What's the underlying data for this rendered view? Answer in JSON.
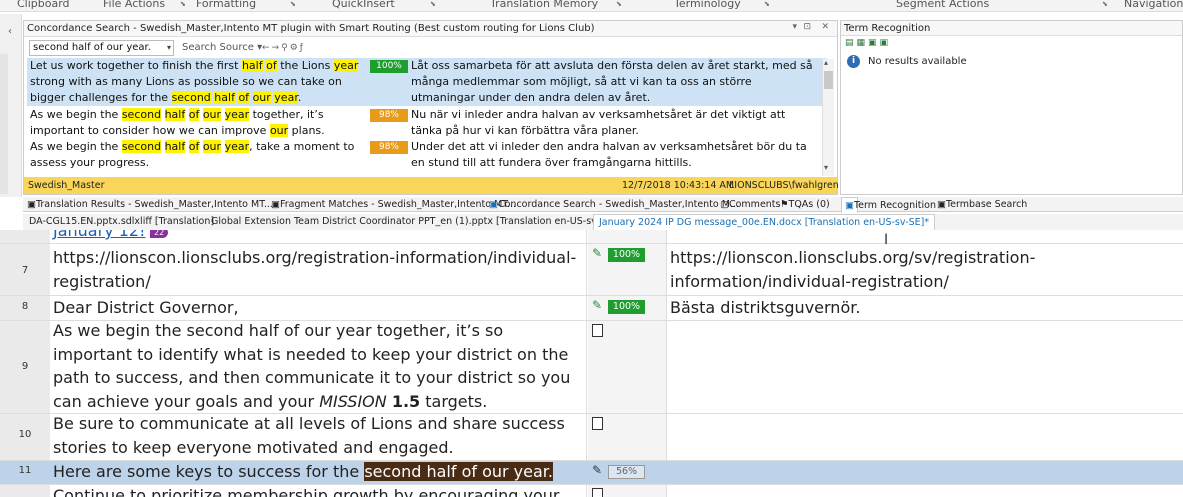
{
  "ribbon": {
    "groups": [
      "Clipboard",
      "File Actions",
      "Formatting",
      "QuickInsert",
      "Translation Memory",
      "Terminology",
      "Segment Actions",
      "Navigation"
    ]
  },
  "concordance": {
    "title": "Concordance Search - Swedish_Master,Intento MT plugin with Smart Routing (Best custom routing for Lions Club)",
    "search_value": "second half of our year.",
    "search_source_label": "Search Source",
    "results": [
      {
        "source": [
          {
            "t": "Let us work together to finish the first "
          },
          {
            "t": "half",
            "h": true
          },
          {
            "t": " "
          },
          {
            "t": "of",
            "h": true
          },
          {
            "t": " the Lions "
          },
          {
            "t": "year",
            "h": true
          },
          {
            "t": " strong with as many Lions as possible so we can take on bigger challenges for the "
          },
          {
            "t": "second",
            "h": true
          },
          {
            "t": " "
          },
          {
            "t": "half",
            "h": true
          },
          {
            "t": " "
          },
          {
            "t": "of",
            "h": true
          },
          {
            "t": " "
          },
          {
            "t": "our",
            "h": true
          },
          {
            "t": " "
          },
          {
            "t": "year",
            "h": true
          },
          {
            "t": "."
          }
        ],
        "score": "100%",
        "target": "Låt oss samarbeta för att avsluta den första delen av året starkt, med så många medlemmar som möjligt, så att vi kan ta oss an större utmaningar under den andra delen av året."
      },
      {
        "source": [
          {
            "t": "As we begin the "
          },
          {
            "t": "second",
            "h": true
          },
          {
            "t": " "
          },
          {
            "t": "half",
            "h": true
          },
          {
            "t": " "
          },
          {
            "t": "of",
            "h": true
          },
          {
            "t": " "
          },
          {
            "t": "our",
            "h": true
          },
          {
            "t": " "
          },
          {
            "t": "year",
            "h": true
          },
          {
            "t": " together, it’s important to consider how we can improve "
          },
          {
            "t": "our",
            "h": true
          },
          {
            "t": " plans."
          }
        ],
        "score": "98%",
        "target": "Nu när vi inleder andra halvan av verksamhetsåret är det viktigt att tänka på hur vi kan förbättra våra planer."
      },
      {
        "source": [
          {
            "t": "As we begin the "
          },
          {
            "t": "second",
            "h": true
          },
          {
            "t": " "
          },
          {
            "t": "half",
            "h": true
          },
          {
            "t": " "
          },
          {
            "t": "of",
            "h": true
          },
          {
            "t": " "
          },
          {
            "t": "our",
            "h": true
          },
          {
            "t": " "
          },
          {
            "t": "year",
            "h": true
          },
          {
            "t": ", take a moment to assess your progress."
          }
        ],
        "score": "98%",
        "target": "Under det att vi inleder den andra halvan av verksamhetsåret bör du ta en stund till att fundera över framgångarna hittills."
      }
    ],
    "status_tm": "Swedish_Master",
    "status_date": "12/7/2018 10:43:14 AM",
    "status_user": "LIONSCLUBS\\fwahlgren"
  },
  "term_recognition": {
    "title": "Term Recognition",
    "message": "No results available"
  },
  "bottom_tabs": [
    "Translation Results - Swedish_Master,Intento MT...",
    "Fragment Matches - Swedish_Master,Intento MT...",
    "Concordance Search - Swedish_Master,Intento M...",
    "Comments",
    "TQAs (0)",
    "Term Recognition",
    "Termbase Search"
  ],
  "doc_tabs": [
    "DA-CGL15.EN.pptx.sdlxliff [Translation]",
    "Global Extension Team District Coordinator PPT_en (1).pptx [Translation en-US-sv-SE]*",
    "January 2024 IP DG message_00e.EN.docx [Translation en-US-sv-SE]*"
  ],
  "editor": {
    "top_partial": "January 12!",
    "top_tag": "22",
    "rows": [
      {
        "num": "7",
        "source": "https://lionscon.lionsclubs.org/registration-information/individual-registration/",
        "status": "100%",
        "target": "https://lionscon.lionsclubs.org/sv/registration-information/individual-registration/"
      },
      {
        "num": "8",
        "source": "Dear District Governor,",
        "status": "100%",
        "target": "Bästa distriktsguvernör."
      },
      {
        "num": "9",
        "source_pre": "As we begin the second half of our year together, it’s so important to identify what is needed to keep your district on the path to success, and then communicate it to your district so you can achieve your goals and your ",
        "source_em": "MISSION",
        "source_mid": " ",
        "source_b": "1.5",
        "source_post": " targets.",
        "target": ""
      },
      {
        "num": "10",
        "source": "Be sure to communicate at all levels of Lions and share success stories to keep everyone motivated and engaged.",
        "target": ""
      },
      {
        "num": "11",
        "source_pre": "Here are some keys to success for the ",
        "source_sel": "second half of our year.",
        "status": "56%",
        "target": ""
      },
      {
        "num": "",
        "source": "Continue to prioritize membership growth by encouraging your",
        "target": ""
      }
    ]
  }
}
